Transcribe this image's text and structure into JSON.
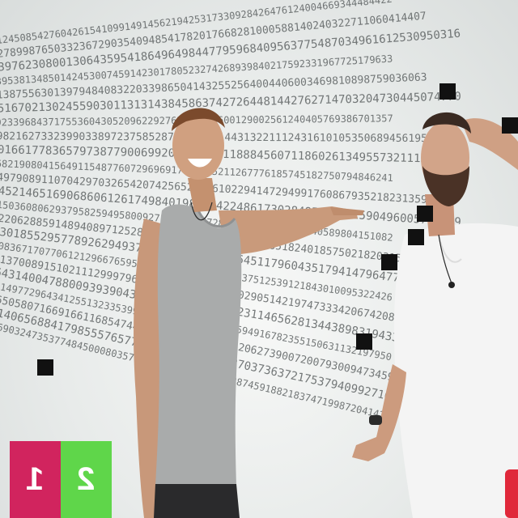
{
  "scene": {
    "description_kind": "video-frame",
    "background_color": "#eceeed",
    "number_text_color": "#4a4f50"
  },
  "scoreboard": {
    "left_score": "1",
    "right_score": "2",
    "left_color": "#d1245e",
    "right_color": "#5fd64a"
  },
  "people": {
    "left": {
      "icon": "person-in-grey-tank-top",
      "shirt_color": "#a9abab"
    },
    "right": {
      "icon": "bearded-man-in-white-tee",
      "shirt_color": "#f4f4f4"
    }
  },
  "accent": {
    "edge_color": "#e0283a"
  }
}
